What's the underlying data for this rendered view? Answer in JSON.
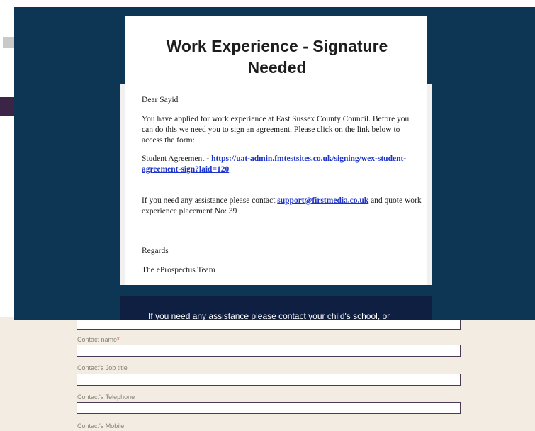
{
  "email": {
    "title": "Work Experience - Signature Needed",
    "greeting": "Dear Sayid",
    "paragraph1": "You have applied for work experience at East Sussex County Council. Before you can do this we need you to sign an agreement. Please click on the link below to access the form:",
    "agreement_prefix": "Student Agreement - ",
    "agreement_link": "https://uat-admin.fmtestsites.co.uk/signing/wex-student-agreement-sign?laid=120",
    "assist_prefix": "If you need any assistance please contact ",
    "assist_link": "support@firstmedia.co.uk",
    "assist_suffix": " and quote work experience placement No: 39",
    "closing": "Regards",
    "signature": "The eProspectus Team",
    "footer_text": "If you need any assistance please contact your child's school, or"
  },
  "form": {
    "fields": [
      {
        "label": "Contact name",
        "required": true
      },
      {
        "label": "Contact's Job title",
        "required": false
      },
      {
        "label": "Contact's Telephone",
        "required": false
      },
      {
        "label": "Contact's Mobile",
        "required": false
      }
    ],
    "required_marker": "*"
  },
  "colors": {
    "overlay_bg": "#0d3654",
    "footer_bg": "#0f1f42",
    "link": "#1b33c8",
    "form_bg": "#f2ece3"
  }
}
